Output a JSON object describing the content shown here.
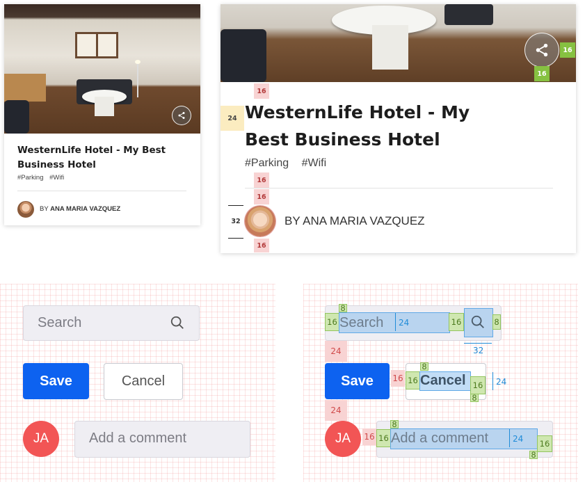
{
  "card": {
    "title": "WesternLife Hotel - My Best Business Hotel",
    "tags": [
      "#Parking",
      "#Wifi"
    ],
    "author_prefix": "BY",
    "author_name": "ANA MARIA VAZQUEZ"
  },
  "spec": {
    "m_16": "16",
    "m_24": "24",
    "m_32": "32",
    "m_8": "8"
  },
  "form": {
    "search_placeholder": "Search",
    "save_label": "Save",
    "cancel_label": "Cancel",
    "avatar_initials": "JA",
    "comment_placeholder": "Add a comment"
  },
  "colors": {
    "primary": "#0d62f0",
    "avatar_bg": "#f25555",
    "field_bg": "#efeef3",
    "spacing_red": "#f8d3d3",
    "spacing_green": "#86c141",
    "measure_blue": "#1f8bd8"
  },
  "icons": {
    "share": "share-icon",
    "search": "search-icon"
  }
}
